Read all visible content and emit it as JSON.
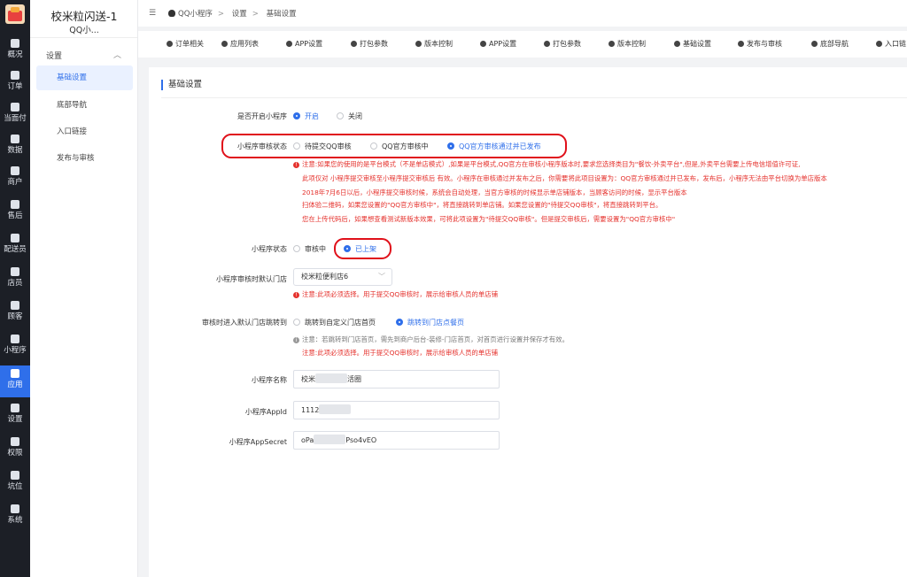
{
  "rail": {
    "items": [
      {
        "label": "概况",
        "icon": "grid-icon"
      },
      {
        "label": "订单",
        "icon": "list-icon"
      },
      {
        "label": "当面付",
        "icon": "scan-icon"
      },
      {
        "label": "数据",
        "icon": "bar-chart-icon"
      },
      {
        "label": "商户",
        "icon": "store-icon"
      },
      {
        "label": "售后",
        "icon": "headset-icon"
      },
      {
        "label": "配送员",
        "icon": "rider-icon"
      },
      {
        "label": "店员",
        "icon": "staff-icon"
      },
      {
        "label": "顾客",
        "icon": "customer-icon"
      },
      {
        "label": "小程序",
        "icon": "wechat-icon"
      },
      {
        "label": "应用",
        "icon": "apps-icon"
      },
      {
        "label": "设置",
        "icon": "settings-icon"
      },
      {
        "label": "权限",
        "icon": "lock-icon"
      },
      {
        "label": "坑位",
        "icon": "slot-icon"
      },
      {
        "label": "系统",
        "icon": "windows-icon"
      }
    ],
    "active_index": 10
  },
  "sidebar": {
    "title": "校米粒闪送-1",
    "subtitle": "QQ小...",
    "group": "设置",
    "items": [
      {
        "label": "基础设置"
      },
      {
        "label": "底部导航"
      },
      {
        "label": "入口链接"
      },
      {
        "label": "发布与审核"
      }
    ]
  },
  "breadcrumb": [
    "QQ小程序",
    "设置",
    "基础设置"
  ],
  "tabs": [
    "订单相关",
    "应用列表",
    "APP设置",
    "打包参数",
    "版本控制",
    "APP设置",
    "打包参数",
    "版本控制",
    "基础设置",
    "发布与审核",
    "底部导航",
    "入口链"
  ],
  "form": {
    "section_title": "基础设置",
    "enable": {
      "label": "是否开启小程序",
      "options": [
        "开启",
        "关闭"
      ],
      "selected": 0
    },
    "audit_status": {
      "label": "小程序审核状态",
      "options": [
        "待提交QQ审核",
        "QQ官方审核中",
        "QQ官方审核通过并已发布"
      ],
      "selected": 2
    },
    "audit_notes": [
      "注意:如果您的使用的是平台模式（不是单店模式）,如果是平台模式,QQ官方在审核小程序版本时,要求您选择类目为\"餐饮-外卖平台\",但是,外卖平台需要上传电信增值许可证,",
      "此项仅对 小程序提交审核至小程序提交审核后 有效。小程序在审核通过并发布之后，你需要将此项目设置为：QQ官方审核通过并已发布，发布后，小程序无法由平台切换为单店版本",
      "2018年7月6日以后，小程序提交审核时候，系统会自动处理，当官方审核的时候显示单店铺版本，当顾客访问的时候，显示平台版本",
      "扫体验二维码，如果您设置的\"QQ官方审核中\"，将直接跳转到单店铺。如果您设置的\"待提交QQ审核\"，将直接跳转到平台。",
      "您在上传代码后，如果想查看测试新版本效果，可将此项设置为\"待提交QQ审核\"。但是提交审核后，需要设置为\"QQ官方审核中\""
    ],
    "mp_status": {
      "label": "小程序状态",
      "options": [
        "审核中",
        "已上架"
      ],
      "selected": 1
    },
    "default_store": {
      "label": "小程序审核时默认门店",
      "value": "校米粒便利店6",
      "note": "注意:此项必须选择。用于提交QQ审核时，展示给审核人员的单店铺"
    },
    "redirect": {
      "label": "审核时进入默认门店跳转到",
      "options": [
        "跳转到自定义门店首页",
        "跳转到门店点餐页"
      ],
      "selected": 1,
      "note_gray": "注意：若跳转到门店首页，需先到商户后台-装修-门店首页，对首页进行设置并保存才有效。",
      "note_red": "注意:此项必须选择。用于提交QQ审核时，展示给审核人员的单店铺"
    },
    "mp_name": {
      "label": "小程序名称",
      "value_start": "校米",
      "value_end": "活圈"
    },
    "app_id": {
      "label": "小程序AppId",
      "value_start": "1112",
      "value_end": ""
    },
    "app_secret": {
      "label": "小程序AppSecret",
      "value_start": "oPa",
      "value_end": "Pso4vEO"
    }
  },
  "colors": {
    "accent": "#2f6fea",
    "warning": "#e5322d",
    "highlight_oval": "#e0101a",
    "rail_bg": "#1c1f26"
  }
}
